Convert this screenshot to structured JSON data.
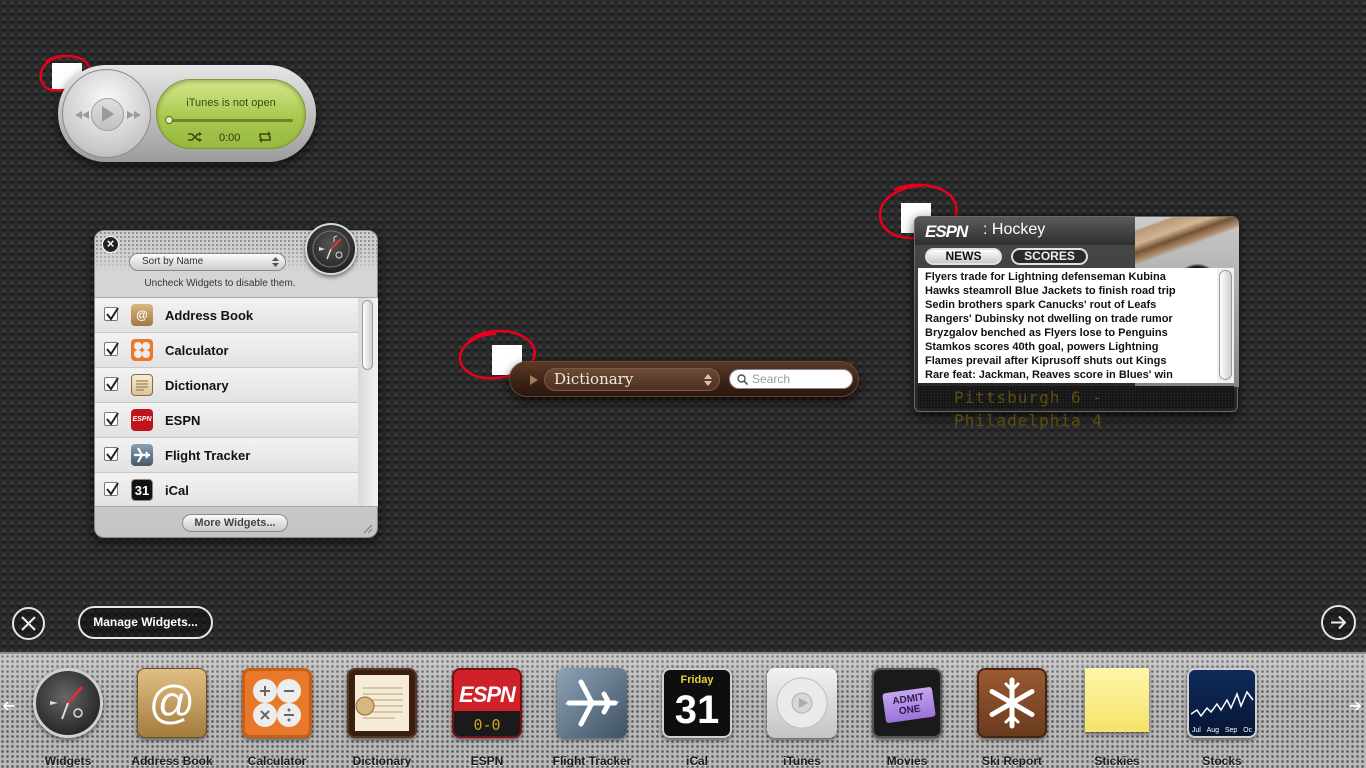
{
  "itunes": {
    "status": "iTunes is not open",
    "time": "0:00"
  },
  "widgets_panel": {
    "sort_label": "Sort by Name",
    "hint": "Uncheck Widgets to disable them.",
    "items": [
      {
        "name": "Address Book",
        "checked": true,
        "icon": "at-sign-icon"
      },
      {
        "name": "Calculator",
        "checked": true,
        "icon": "calculator-icon"
      },
      {
        "name": "Dictionary",
        "checked": true,
        "icon": "book-icon"
      },
      {
        "name": "ESPN",
        "checked": true,
        "icon": "espn-icon"
      },
      {
        "name": "Flight Tracker",
        "checked": true,
        "icon": "airplane-icon"
      },
      {
        "name": "iCal",
        "checked": true,
        "icon": "calendar-icon"
      }
    ],
    "ical_day": "31",
    "espn_small": "ESPN",
    "more_label": "More Widgets..."
  },
  "dictionary": {
    "selected": "Dictionary",
    "search_placeholder": "Search"
  },
  "espn": {
    "logo": "ESPN",
    "title": ": Hockey",
    "tabs": [
      "NEWS",
      "SCORES"
    ],
    "headlines": [
      "Flyers trade for Lightning defenseman Kubina",
      "Hawks steamroll Blue Jackets to finish road trip",
      "Sedin brothers spark Canucks' rout of Leafs",
      "Rangers' Dubinsky not dwelling on trade rumor",
      "Bryzgalov benched as Flyers lose to Penguins",
      "Stamkos scores 40th goal, powers Lightning",
      "Flames prevail after Kiprusoff shuts out Kings",
      "Rare feat: Jackman, Reaves score in Blues' win"
    ],
    "ticker": "Pittsburgh 6 - Philadelphia 4"
  },
  "controls": {
    "manage_label": "Manage Widgets..."
  },
  "widget_bar": {
    "tiles": [
      {
        "label": "Widgets"
      },
      {
        "label": "Address Book"
      },
      {
        "label": "Calculator"
      },
      {
        "label": "Dictionary"
      },
      {
        "label": "ESPN"
      },
      {
        "label": "Flight Tracker"
      },
      {
        "label": "iCal"
      },
      {
        "label": "iTunes"
      },
      {
        "label": "Movies"
      },
      {
        "label": "Ski Report"
      },
      {
        "label": "Stickies"
      },
      {
        "label": "Stocks"
      }
    ],
    "ical_weekday": "Friday",
    "ical_day": "31",
    "espn_score": "0-0",
    "movies_text": "ADMIT ONE",
    "stocks_months": [
      "Jul",
      "Aug",
      "Sep",
      "Oc"
    ]
  },
  "colors": {
    "annotation_red": "#e8001c",
    "lcd_green": "#a9c84f",
    "espn_red": "#c0141c",
    "dictionary_brown": "#3b2216"
  }
}
